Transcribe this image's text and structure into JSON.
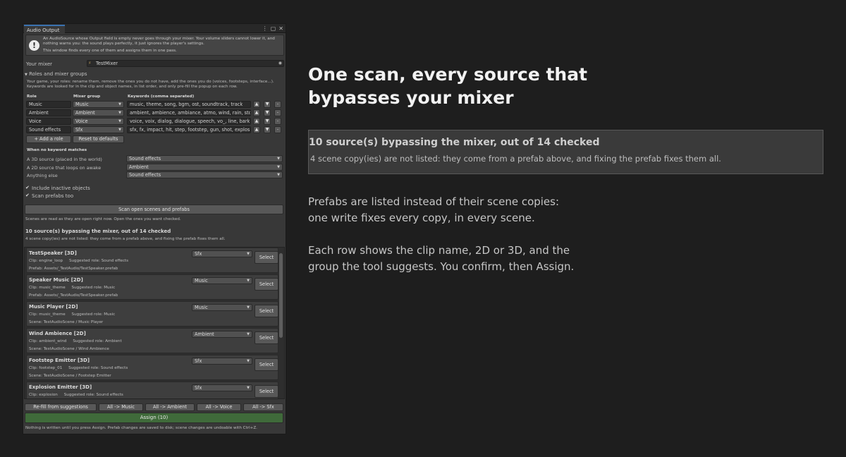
{
  "window": {
    "tab_title": "Audio Output",
    "help_line1": "An AudioSource whose Output field is empty never goes through your mixer. Your volume sliders cannot lower it, and nothing warns you: the sound plays perfectly, it just ignores the player's settings.",
    "help_line2": "This window finds every one of them and assigns them in one pass.",
    "mixer_label": "Your mixer",
    "mixer_value": "TestMixer",
    "roles_foldout": "Roles and mixer groups",
    "roles_help": "Your game, your roles: rename them, remove the ones you do not have, add the ones you do (voices, footsteps, interface...). Keywords are looked for in the clip and object names, in list order, and only pre-fill the popup on each row.",
    "col_role": "Role",
    "col_group": "Mixer group",
    "col_keywords": "Keywords (comma separated)",
    "roles": [
      {
        "role": "Music",
        "group": "Music",
        "keywords": "music, theme, song, bgm, ost, soundtrack, track"
      },
      {
        "role": "Ambient",
        "group": "Ambient",
        "keywords": "ambient, ambience, ambiance, atmo, wind, rain, storm"
      },
      {
        "role": "Voice",
        "group": "Voice",
        "keywords": "voice, voix, dialog, dialogue, speech, vo_, line, bark, na"
      },
      {
        "role": "Sound effects",
        "group": "Sfx",
        "keywords": "sfx, fx, impact, hit, step, footstep, gun, shot, explosion,"
      }
    ],
    "add_role": "+ Add a role",
    "reset_defaults": "Reset to defaults",
    "fallback_header": "When no keyword matches",
    "fallbacks": [
      {
        "label": "A 3D source (placed in the world)",
        "value": "Sound effects"
      },
      {
        "label": "A 2D source that loops on awake",
        "value": "Ambient"
      },
      {
        "label": "Anything else",
        "value": "Sound effects"
      }
    ],
    "include_inactive": "Include inactive objects",
    "scan_prefabs": "Scan prefabs too",
    "scan_button": "Scan open scenes and prefabs",
    "scan_note": "Scenes are read as they are open right now. Open the ones you want checked.",
    "result_title": "10 source(s) bypassing the mixer, out of 14 checked",
    "result_note": "4 scene copy(ies) are not listed: they come from a prefab above, and fixing the prefab fixes them all.",
    "select_label": "Select",
    "rows": [
      {
        "title": "TestSpeaker   [3D]",
        "group": "Sfx",
        "clip": "Clip: engine_loop",
        "role": "Suggested role: Sound effects",
        "path": "Prefab: Assets/_TestAudio/TestSpeaker.prefab"
      },
      {
        "title": "Speaker Music   [2D]",
        "group": "Music",
        "clip": "Clip: music_theme",
        "role": "Suggested role: Music",
        "path": "Prefab: Assets/_TestAudio/TestSpeaker.prefab"
      },
      {
        "title": "Music Player   [2D]",
        "group": "Music",
        "clip": "Clip: music_theme",
        "role": "Suggested role: Music",
        "path": "Scene: TestAudioScene / Music Player"
      },
      {
        "title": "Wind Ambience   [2D]",
        "group": "Ambient",
        "clip": "Clip: ambient_wind",
        "role": "Suggested role: Ambient",
        "path": "Scene: TestAudioScene / Wind Ambience"
      },
      {
        "title": "Footstep Emitter   [3D]",
        "group": "Sfx",
        "clip": "Clip: footstep_01",
        "role": "Suggested role: Sound effects",
        "path": "Scene: TestAudioScene / Footstep Emitter"
      },
      {
        "title": "Explosion Emitter   [3D]",
        "group": "Sfx",
        "clip": "Clip: explosion",
        "role": "Suggested role: Sound effects",
        "path": ""
      }
    ],
    "bulk": [
      "Re-fill from suggestions",
      "All -> Music",
      "All -> Ambient",
      "All -> Voice",
      "All -> Sfx"
    ],
    "assign_button": "Assign (10)",
    "footer_note": "Nothing is written until you press Assign. Prefab changes are saved to disk; scene changes are undoable with Ctrl+Z."
  },
  "marketing": {
    "headline": "One scan, every source that bypasses your mixer",
    "summary_title": "10 source(s) bypassing the mixer, out of 14 checked",
    "summary_note": "4 scene copy(ies) are not listed: they come from a prefab above, and fixing the prefab fixes them all.",
    "para1_line1": "Prefabs are listed instead of their scene copies:",
    "para1_line2": "one write fixes every copy, in every scene.",
    "para2_line1": "Each row shows the clip name, 2D or 3D, and the",
    "para2_line2": "group the tool suggests. You confirm, then Assign."
  },
  "icons": {
    "help": "info-icon",
    "mixer": "mixer-asset-icon",
    "picker": "object-picker-icon",
    "arrow_down": "chevron-down-icon",
    "move_up": "arrow-up-icon",
    "move_down": "arrow-down-icon",
    "remove": "minus-icon",
    "menu": "kebab-menu-icon",
    "maximize": "maximize-icon",
    "close": "close-icon",
    "check": "check-icon",
    "foldout": "foldout-triangle-icon"
  }
}
